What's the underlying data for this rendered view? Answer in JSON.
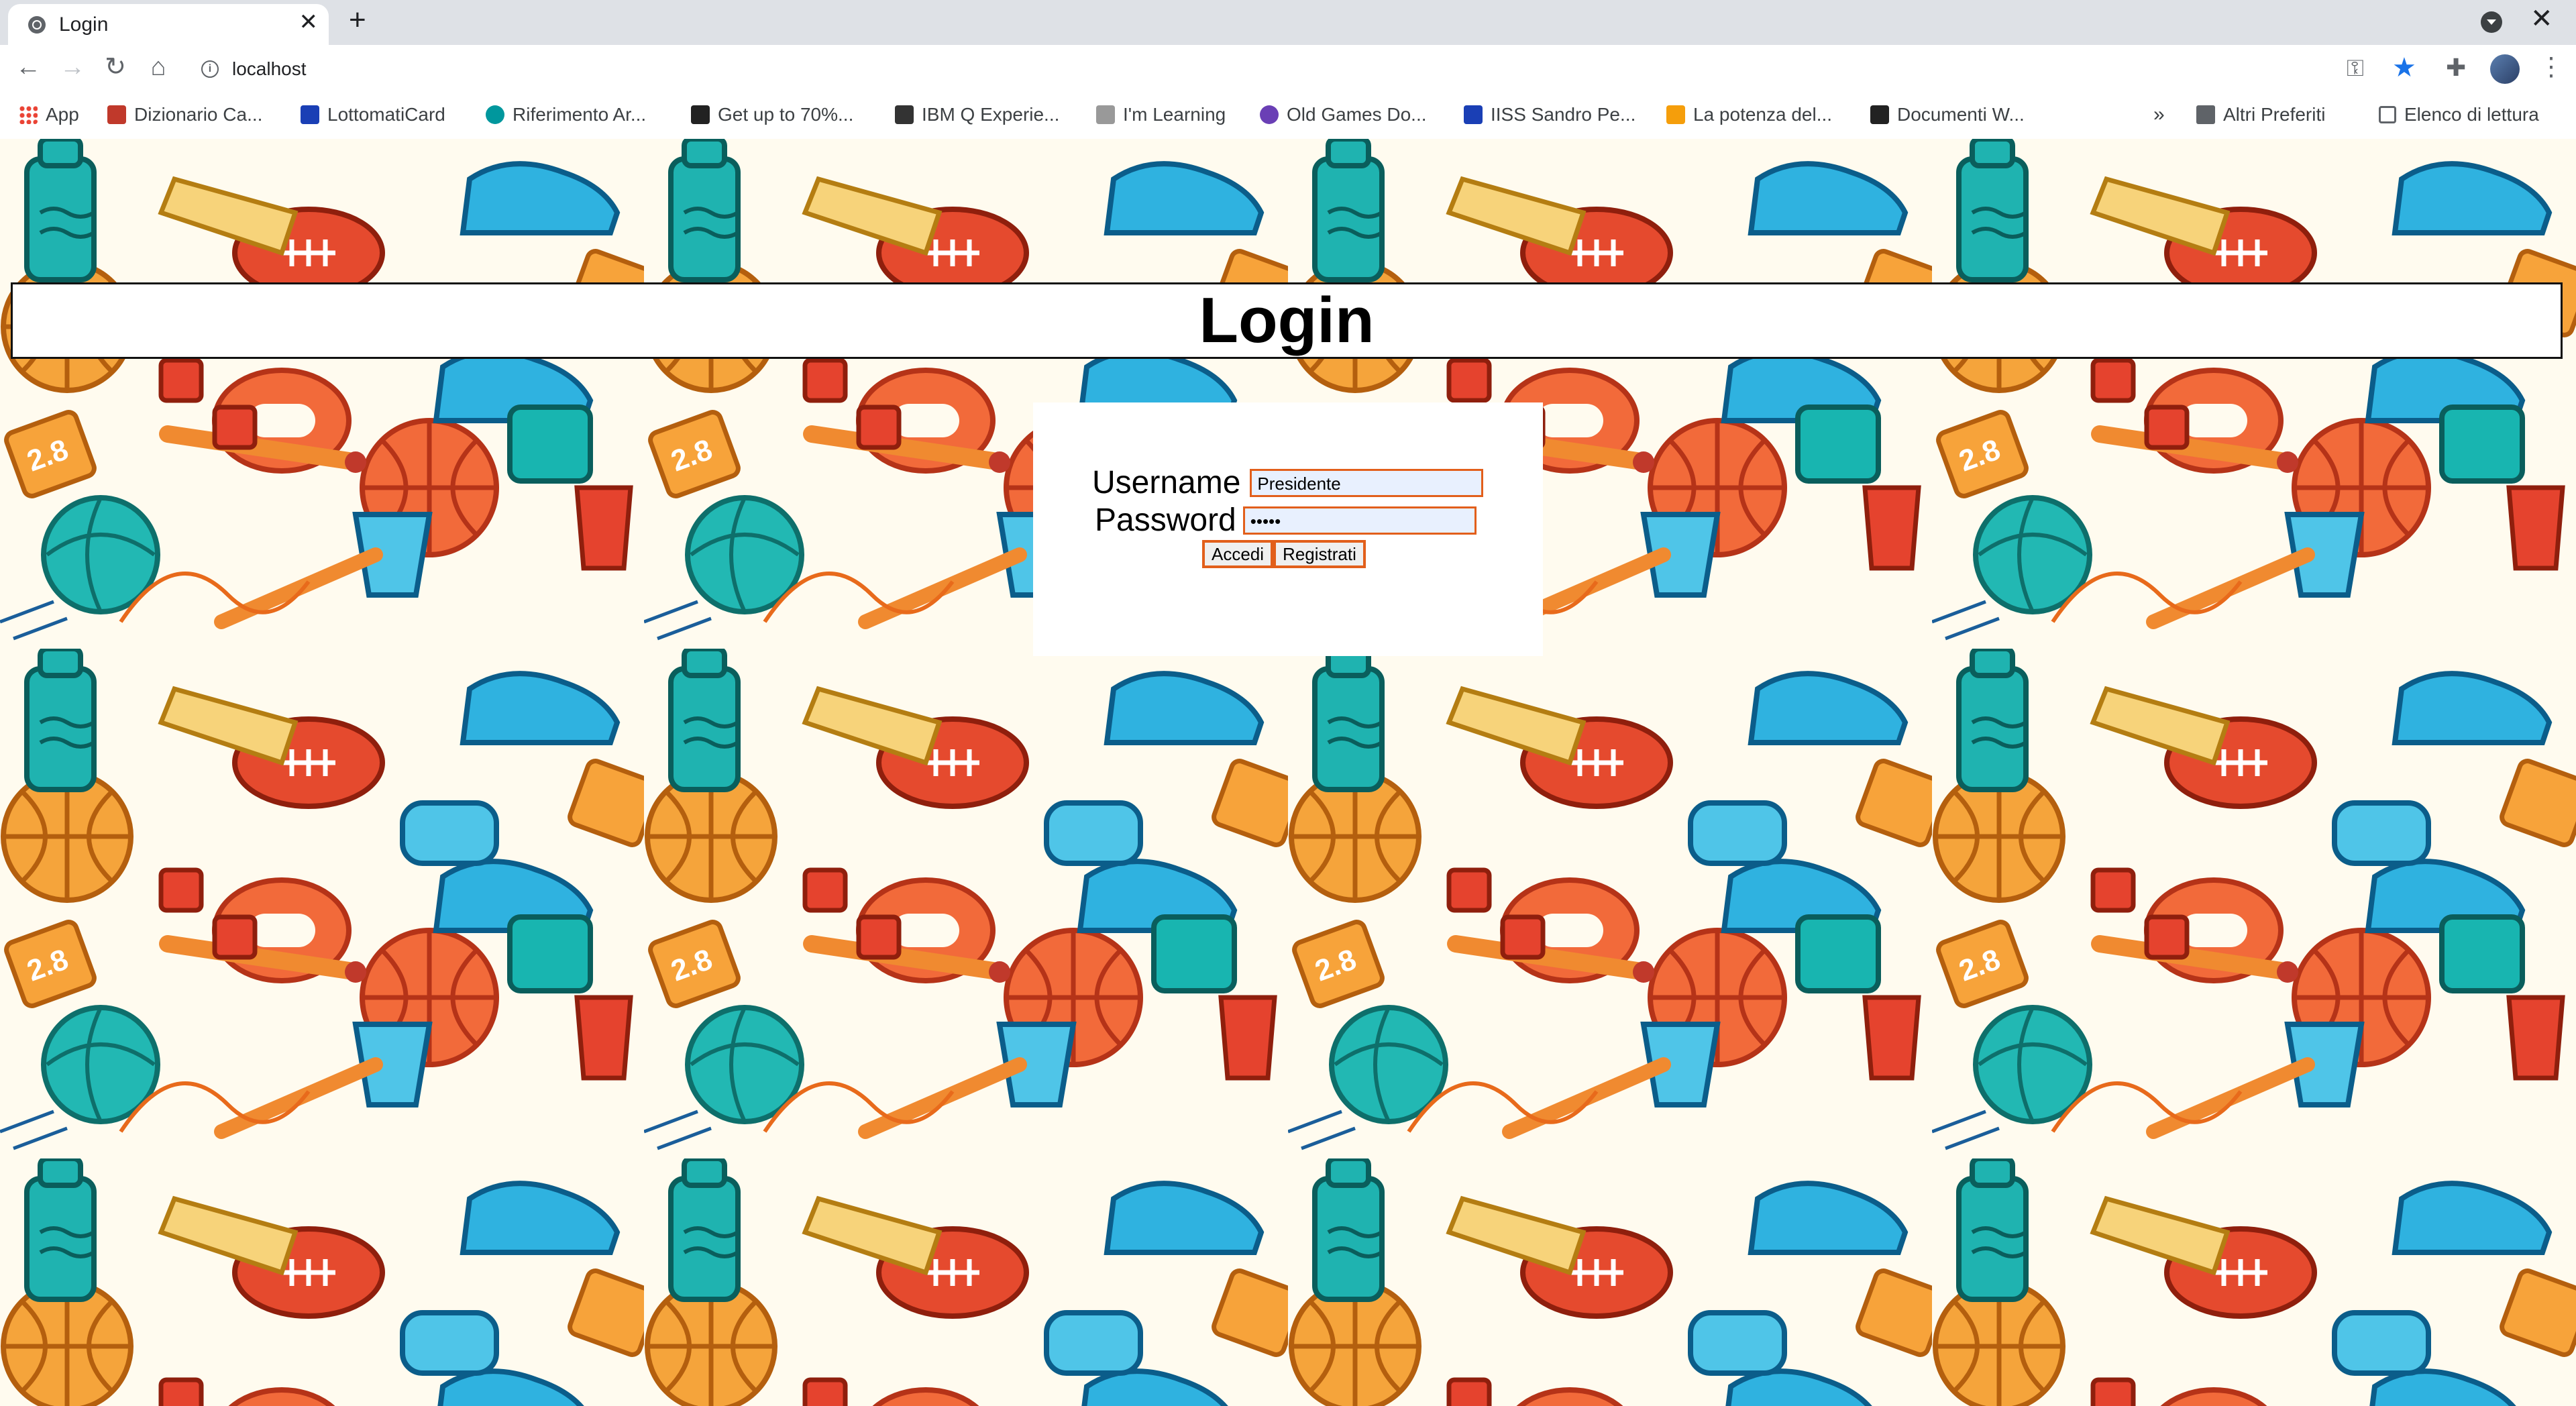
{
  "browser": {
    "tab_title": "Login",
    "new_tab": "+",
    "close_tab": "✕",
    "url": "localhost",
    "bookmarks": [
      {
        "label": "App",
        "icon": "apps-grid-icon",
        "color": "#ea4335"
      },
      {
        "label": "Dizionario Ca...",
        "icon": "shield-icon",
        "color": "#c0392b"
      },
      {
        "label": "LottomatiCard",
        "icon": "s-logo-icon",
        "color": "#1a3fb5"
      },
      {
        "label": "Riferimento Ar...",
        "icon": "arduino-icon",
        "color": "#00979d"
      },
      {
        "label": "Get up to 70%...",
        "icon": "com-logo-icon",
        "color": "#222"
      },
      {
        "label": "IBM Q Experie...",
        "icon": "q-logo-icon",
        "color": "#333"
      },
      {
        "label": "I'm Learning",
        "icon": "learning-icon",
        "color": "#888"
      },
      {
        "label": "Old Games Do...",
        "icon": "globe-icon",
        "color": "#6a3fb5"
      },
      {
        "label": "IISS Sandro Pe...",
        "icon": "school-icon",
        "color": "#1a3fb5"
      },
      {
        "label": "La potenza del...",
        "icon": "amazon-icon",
        "color": "#f59e0b"
      },
      {
        "label": "Documenti W...",
        "icon": "document-icon",
        "color": "#222"
      }
    ],
    "more": "»",
    "other_bookmarks": "Altri Preferiti",
    "reading_list": "Elenco di lettura"
  },
  "page": {
    "heading": "Login",
    "username_label": "Username",
    "username_value": "Presidente",
    "password_label": "Password",
    "password_value": "•••••",
    "login_button": "Accedi",
    "register_button": "Registrati",
    "accent_color": "#e25f1b"
  }
}
